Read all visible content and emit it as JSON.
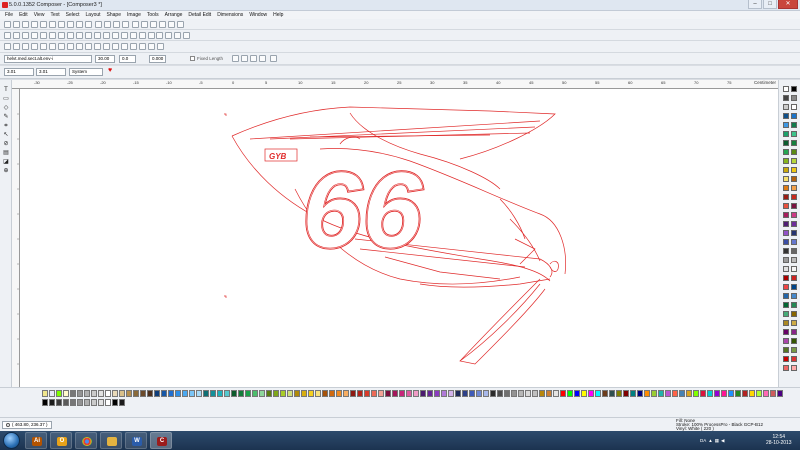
{
  "window": {
    "title": "5.0.0.1352 Composer - [Composer3 *]",
    "controls": [
      "–",
      "□",
      "✕"
    ]
  },
  "menu": [
    "File",
    "Edit",
    "View",
    "Text",
    "Select",
    "Layout",
    "Shape",
    "Image",
    "Tools",
    "Arrange",
    "Detail Edit",
    "Dimensions",
    "Window",
    "Help"
  ],
  "properties": {
    "font": "helvt.med.sect.alt.env-i",
    "size": "30.00",
    "spacing": "0.0",
    "kerning": "0.000",
    "fixed_length_label": "Fixed Length",
    "fixed_length_checked": false,
    "width_value": "3.01",
    "height_value": "3.01",
    "color_system": "System"
  },
  "ruler": {
    "unit": "Centimeter",
    "labels": [
      "-30",
      "-25",
      "-20",
      "-15",
      "-10",
      "-5",
      "0",
      "5",
      "10",
      "15",
      "20",
      "25",
      "30",
      "35",
      "40",
      "45",
      "50",
      "55",
      "60",
      "65",
      "70",
      "75"
    ]
  },
  "artwork": {
    "number_text": "66",
    "stroke_color": "#e02a2a",
    "badge_text": "GYB"
  },
  "status": {
    "coordinates": "( 463.80, 236.37 )",
    "fill": "Fill: None",
    "stroke": "Stroke: 100% ProcessPro - Black GCP-B12",
    "vinyl": "Vinyl: White ( 220 )"
  },
  "taskbar": {
    "apps": [
      "illustrator",
      "outlook",
      "chrome",
      "explorer",
      "word",
      "composer"
    ],
    "lang": "DA",
    "time": "12:54",
    "date": "28-10-2013"
  },
  "palette": {
    "bottom": [
      "#000000",
      "#1b1b1b",
      "#3a3a3a",
      "#5a5a5a",
      "#777777",
      "#939393",
      "#b0b0b0",
      "#cbcbcb",
      "#e2e2e2",
      "#ffffff",
      "#e8d9b8",
      "#d9c08a",
      "#b58f4f",
      "#8a6a3a",
      "#6b4a2a",
      "#4d2f1c",
      "#0e3d7a",
      "#1757a6",
      "#1f6fd1",
      "#2e8fe6",
      "#4aa8f0",
      "#7ac4f5",
      "#a9dbf8",
      "#0f6f74",
      "#14909a",
      "#1fb2bb",
      "#56c9cf",
      "#0b5a2b",
      "#127d3a",
      "#1aa14a",
      "#4cbd6c",
      "#8dd69b",
      "#5a7d12",
      "#7ea61a",
      "#a8cc28",
      "#cfe07b",
      "#b08a0a",
      "#d8ae0f",
      "#f5cf1e",
      "#f8e27a",
      "#a5520b",
      "#d06a10",
      "#f08a22",
      "#f6ad62",
      "#8e1a12",
      "#b5231a",
      "#d83a2a",
      "#ec6a57",
      "#f3a295",
      "#7a0f3d",
      "#a3165a",
      "#c8257a",
      "#e05aa0",
      "#f09bc5",
      "#4a1a6e",
      "#662597",
      "#8a3cc0",
      "#b07ad8",
      "#d2b2ea",
      "#1d2a5a",
      "#2c3f86",
      "#3f5bb8",
      "#6f88d6",
      "#a7b8ea",
      "#2a2a2a",
      "#4d4d4d",
      "#707070",
      "#939393",
      "#b6b6b6",
      "#d9d9d9",
      "#c0c0c0",
      "#b8860b",
      "#cd7f32",
      "#e5e4e2",
      "#ff0000",
      "#00ff00",
      "#0000ff",
      "#ffff00",
      "#ff00ff",
      "#00ffff",
      "#6c3b1a",
      "#2f4f4f",
      "#808000",
      "#800000",
      "#008080",
      "#000080",
      "#ff8c00",
      "#9acd32",
      "#20b2aa",
      "#ba55d3",
      "#ff6347",
      "#4682b4",
      "#daa520",
      "#7fff00",
      "#dc143c",
      "#00ced1",
      "#9400d3",
      "#ff1493",
      "#1e90ff",
      "#228b22",
      "#b22222",
      "#ffd700",
      "#adff2f",
      "#ff69b4",
      "#cd5c5c",
      "#4b0082",
      "#f0e68c",
      "#e6e6fa",
      "#7cfc00",
      "#fffacd"
    ],
    "right": [
      "#ffffff",
      "#000000",
      "#444444",
      "#888888",
      "#cccccc",
      "#ffffff",
      "#0d4f8a",
      "#1a73c9",
      "#3d97e3",
      "#0f7a4d",
      "#1aa06a",
      "#3bc48c",
      "#0a5c2f",
      "#14803f",
      "#25a652",
      "#5a8a14",
      "#86b41f",
      "#b6d73a",
      "#c9a80b",
      "#efc814",
      "#f7e06a",
      "#b3600e",
      "#de7a12",
      "#f3a04a",
      "#9a1c14",
      "#c7281c",
      "#e6503e",
      "#7a1240",
      "#a61d5e",
      "#cc3a86",
      "#4e1d73",
      "#6d2c9c",
      "#9152c7",
      "#263470",
      "#3a4ea6",
      "#6477cf",
      "#333333",
      "#666666",
      "#999999",
      "#bbbbbb",
      "#e0e0e0",
      "#f5f5f5",
      "#aa0000",
      "#cc2222",
      "#ee4444",
      "#004488",
      "#2266aa",
      "#4488cc",
      "#006633",
      "#228855",
      "#44aa77",
      "#886600",
      "#aa8822",
      "#ccaa44",
      "#660066",
      "#882288",
      "#aa44aa",
      "#335500",
      "#557722",
      "#779944",
      "#cc0000",
      "#dd3333",
      "#ee6666",
      "#ffaaaa"
    ]
  }
}
